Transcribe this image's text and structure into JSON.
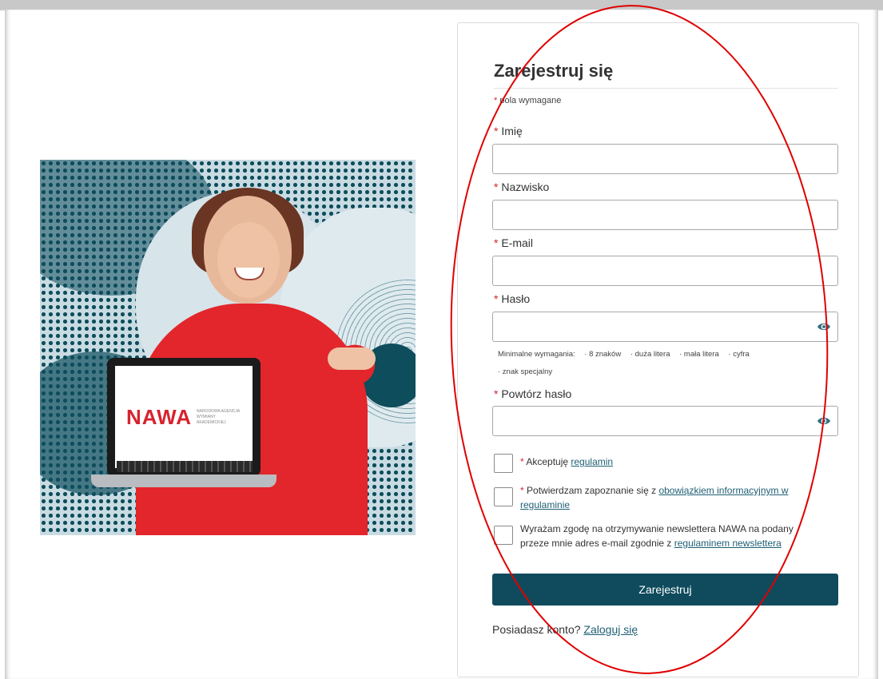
{
  "form": {
    "title": "Zarejestruj się",
    "required_mark": "*",
    "required_note": "pola wymagane",
    "first_name_label": "Imię",
    "last_name_label": "Nazwisko",
    "email_label": "E-mail",
    "password_label": "Hasło",
    "password_repeat_label": "Powtórz hasło",
    "first_name_value": "",
    "last_name_value": "",
    "email_value": "",
    "password_value": "",
    "password_repeat_value": "",
    "requirements": {
      "intro": "Minimalne wymagania:",
      "items": [
        "· 8 znaków",
        "· duża litera",
        "· mała litera",
        "· cyfra",
        "· znak specjalny"
      ]
    },
    "consents": [
      {
        "required": true,
        "text": "Akceptuję ",
        "link": "regulamin",
        "after": ""
      },
      {
        "required": true,
        "text": "Potwierdzam zapoznanie się z ",
        "link": "obowiązkiem informacyjnym w regulaminie",
        "after": ""
      },
      {
        "required": false,
        "text": "Wyrażam zgodę na otrzymywanie newslettera NAWA na podany przeze mnie adres e-mail zgodnie z ",
        "link": "regulaminem newslettera",
        "after": ""
      }
    ],
    "submit_label": "Zarejestruj",
    "login_prompt": "Posiadasz konto?",
    "login_link": "Zaloguj się"
  },
  "hero": {
    "logo_text": "NAWA",
    "logo_subtext": "NARODOWA AGENCJA WYMIANY AKADEMICKIEJ"
  },
  "colors": {
    "primary": "#0f4b5c",
    "required": "#d6232e",
    "link": "#1e5f74",
    "annotation": "#e00000",
    "sweater": "#e3262b"
  },
  "icons": {
    "password_toggle": "eye-icon"
  }
}
